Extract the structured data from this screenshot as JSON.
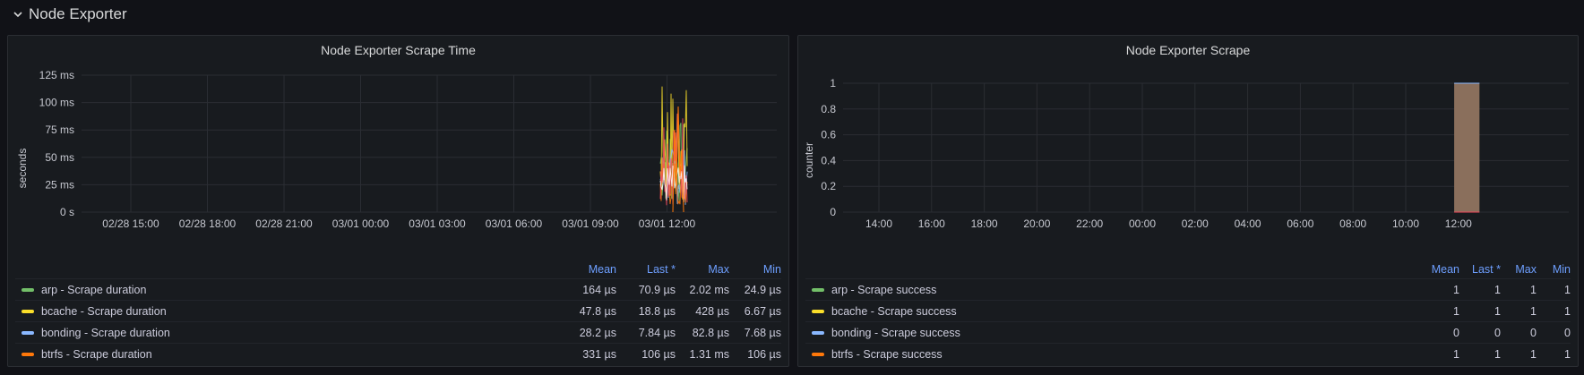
{
  "row": {
    "title": "Node Exporter"
  },
  "panels": {
    "left": {
      "title": "Node Exporter Scrape Time",
      "legend_columns": [
        "Mean",
        "Last *",
        "Max",
        "Min"
      ],
      "legend": [
        {
          "name": "arp - Scrape duration",
          "color": "#73bf69",
          "mean": "164 µs",
          "last": "70.9 µs",
          "max": "2.02 ms",
          "min": "24.9 µs"
        },
        {
          "name": "bcache - Scrape duration",
          "color": "#fade2a",
          "mean": "47.8 µs",
          "last": "18.8 µs",
          "max": "428 µs",
          "min": "6.67 µs"
        },
        {
          "name": "bonding - Scrape duration",
          "color": "#8ab8ff",
          "mean": "28.2 µs",
          "last": "7.84 µs",
          "max": "82.8 µs",
          "min": "7.68 µs"
        },
        {
          "name": "btrfs - Scrape duration",
          "color": "#ff780a",
          "mean": "331 µs",
          "last": "106 µs",
          "max": "1.31 ms",
          "min": "106 µs"
        }
      ]
    },
    "right": {
      "title": "Node Exporter Scrape",
      "legend_columns": [
        "Mean",
        "Last *",
        "Max",
        "Min"
      ],
      "legend": [
        {
          "name": "arp - Scrape success",
          "color": "#73bf69",
          "mean": "1",
          "last": "1",
          "max": "1",
          "min": "1"
        },
        {
          "name": "bcache - Scrape success",
          "color": "#fade2a",
          "mean": "1",
          "last": "1",
          "max": "1",
          "min": "1"
        },
        {
          "name": "bonding - Scrape success",
          "color": "#8ab8ff",
          "mean": "0",
          "last": "0",
          "max": "0",
          "min": "0"
        },
        {
          "name": "btrfs - Scrape success",
          "color": "#ff780a",
          "mean": "1",
          "last": "1",
          "max": "1",
          "min": "1"
        }
      ]
    }
  },
  "chart_data": [
    {
      "type": "line",
      "title": "Node Exporter Scrape Time",
      "ylabel": "seconds",
      "y_ticks": [
        "0 s",
        "25 ms",
        "50 ms",
        "75 ms",
        "100 ms",
        "125 ms"
      ],
      "ylim": [
        0,
        125
      ],
      "x_ticks": [
        "02/28 15:00",
        "02/28 18:00",
        "02/28 21:00",
        "03/01 00:00",
        "03/01 03:00",
        "03/01 06:00",
        "03/01 09:00",
        "03/01 12:00"
      ],
      "note_series": "spiky activity only near the right end (~03/01 11:00–12:30), peaks up to ~110 ms",
      "series_colors": [
        "#73bf69",
        "#fade2a",
        "#8ab8ff",
        "#ff780a",
        "#f2495c",
        "#ffffff"
      ]
    },
    {
      "type": "area",
      "title": "Node Exporter Scrape",
      "ylabel": "counter",
      "y_ticks": [
        "0",
        "0.2",
        "0.4",
        "0.6",
        "0.8",
        "1"
      ],
      "ylim": [
        0,
        1
      ],
      "x_ticks": [
        "14:00",
        "16:00",
        "18:00",
        "20:00",
        "22:00",
        "00:00",
        "02:00",
        "04:00",
        "06:00",
        "08:00",
        "10:00",
        "12:00"
      ],
      "filled_region": {
        "from": "~11:50",
        "to": "12:30",
        "value": 1
      },
      "fill_color": "#8a6f5c"
    }
  ]
}
